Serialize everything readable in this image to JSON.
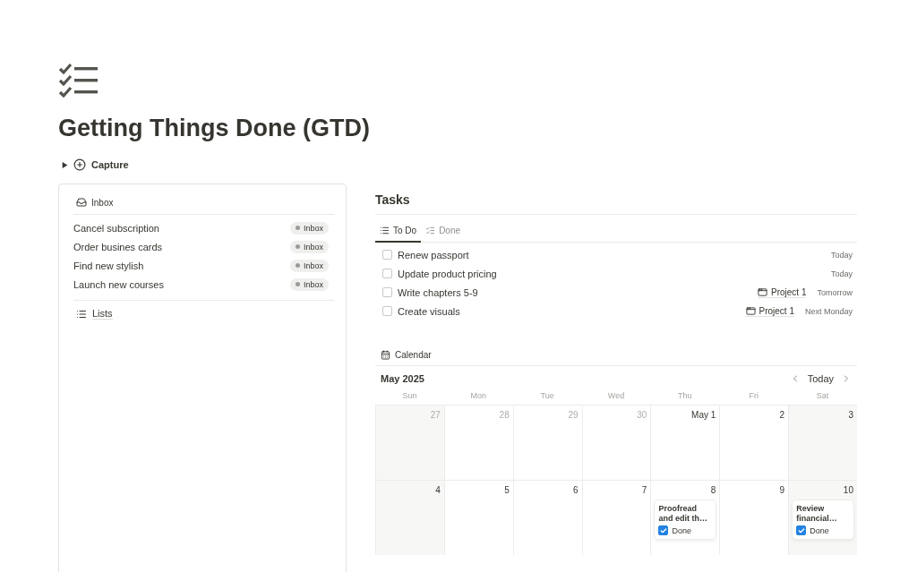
{
  "page": {
    "title": "Getting Things Done (GTD)"
  },
  "capture": {
    "label": "Capture",
    "expanded": false
  },
  "inbox": {
    "title": "Inbox",
    "items": [
      {
        "name": "Cancel subscription",
        "tag": "Inbox"
      },
      {
        "name": "Order busines cards",
        "tag": "Inbox"
      },
      {
        "name": "Find new stylish",
        "tag": "Inbox"
      },
      {
        "name": "Launch new courses",
        "tag": "Inbox"
      }
    ]
  },
  "lists": {
    "title": "Lists"
  },
  "tasks": {
    "title": "Tasks",
    "tabs": [
      {
        "label": "To Do",
        "selected": true
      },
      {
        "label": "Done",
        "selected": false
      }
    ],
    "items": [
      {
        "name": "Renew passport",
        "checked": false,
        "date": "Today"
      },
      {
        "name": "Update product pricing",
        "checked": false,
        "date": "Today"
      },
      {
        "name": "Write chapters 5-9",
        "checked": false,
        "project": "Project 1",
        "date": "Tomorrow"
      },
      {
        "name": "Create visuals",
        "checked": false,
        "project": "Project 1",
        "date": "Next Monday"
      }
    ]
  },
  "calendar": {
    "title": "Calendar",
    "month": "May 2025",
    "today_button": "Today",
    "weekdays": [
      "Sun",
      "Mon",
      "Tue",
      "Wed",
      "Thu",
      "Fri",
      "Sat"
    ],
    "weeks": [
      [
        {
          "day": "27",
          "outside": true
        },
        {
          "day": "28",
          "outside": true
        },
        {
          "day": "29",
          "outside": true
        },
        {
          "day": "30",
          "outside": true
        },
        {
          "day": "May 1",
          "outside": false
        },
        {
          "day": "2",
          "outside": false
        },
        {
          "day": "3",
          "outside": false
        }
      ],
      [
        {
          "day": "4",
          "outside": false
        },
        {
          "day": "5",
          "outside": false
        },
        {
          "day": "6",
          "outside": false
        },
        {
          "day": "7",
          "outside": false
        },
        {
          "day": "8",
          "outside": false,
          "events": [
            {
              "title": "Proofread and edit th…",
              "status": "Done",
              "checked": true
            }
          ]
        },
        {
          "day": "9",
          "outside": false
        },
        {
          "day": "10",
          "outside": false,
          "events": [
            {
              "title": "Review financial…",
              "status": "Done",
              "checked": true
            }
          ]
        }
      ]
    ]
  }
}
